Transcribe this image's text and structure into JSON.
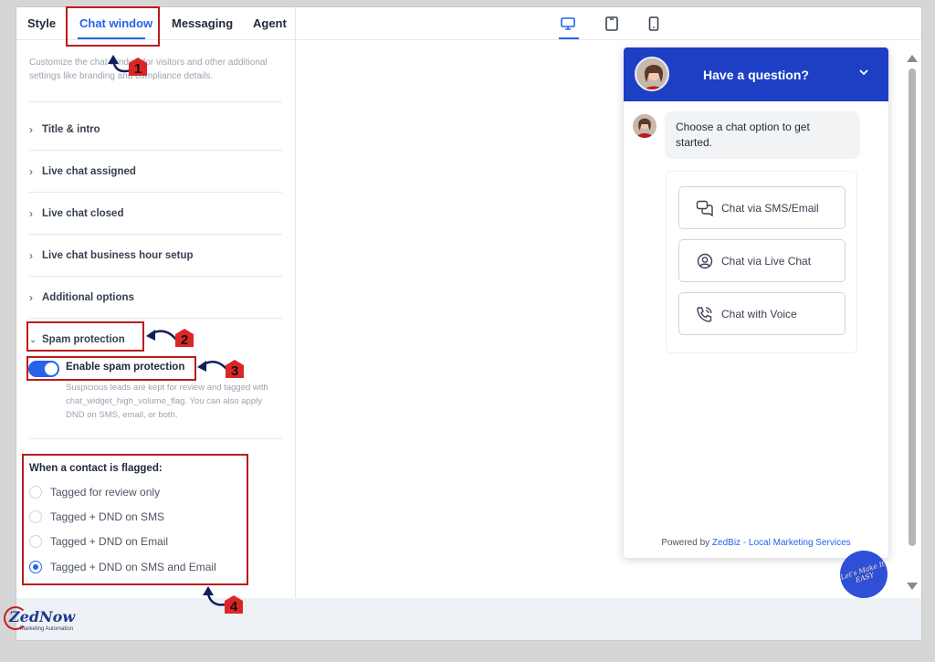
{
  "tabs": [
    {
      "label": "Style"
    },
    {
      "label": "Chat window"
    },
    {
      "label": "Messaging"
    },
    {
      "label": "Agent"
    }
  ],
  "description": "Customize the chat window for visitors and other additional settings like branding and compliance details.",
  "sections": [
    {
      "label": "Title & intro"
    },
    {
      "label": "Live chat assigned"
    },
    {
      "label": "Live chat closed"
    },
    {
      "label": "Live chat business hour setup"
    },
    {
      "label": "Additional options"
    },
    {
      "label": "Spam protection"
    }
  ],
  "spam": {
    "toggle_label": "Enable spam protection",
    "enabled": true,
    "help": "Suspicious leads are kept for review and tagged with chat_widget_high_volume_flag. You can also apply DND on SMS, email, or both."
  },
  "flagged": {
    "title": "When a contact is flagged:",
    "options": [
      {
        "label": "Tagged for review only",
        "checked": false
      },
      {
        "label": "Tagged + DND on SMS",
        "checked": false
      },
      {
        "label": "Tagged + DND on Email",
        "checked": false
      },
      {
        "label": "Tagged + DND on SMS and Email",
        "checked": true
      }
    ]
  },
  "annotations": [
    "1",
    "2",
    "3",
    "4"
  ],
  "devices": [
    "desktop-icon",
    "tablet-icon",
    "mobile-icon"
  ],
  "widget": {
    "header_title": "Have a question?",
    "greeting": "Choose a chat option to get started.",
    "options": [
      {
        "label": "Chat via SMS/Email",
        "icon": "chat-bubbles-icon"
      },
      {
        "label": "Chat via Live Chat",
        "icon": "user-circle-icon"
      },
      {
        "label": "Chat with Voice",
        "icon": "phone-icon"
      }
    ],
    "powered_prefix": "Powered by",
    "powered_brand": "ZedBiz - Local Marketing Services"
  },
  "badge_text": "Let's Make It EASY",
  "logo": {
    "name": "ZedNow",
    "tagline": "Marketing Automation"
  },
  "colors": {
    "accent": "#2563eb",
    "header": "#1d3fc4",
    "annotation": "#b91c1c"
  }
}
